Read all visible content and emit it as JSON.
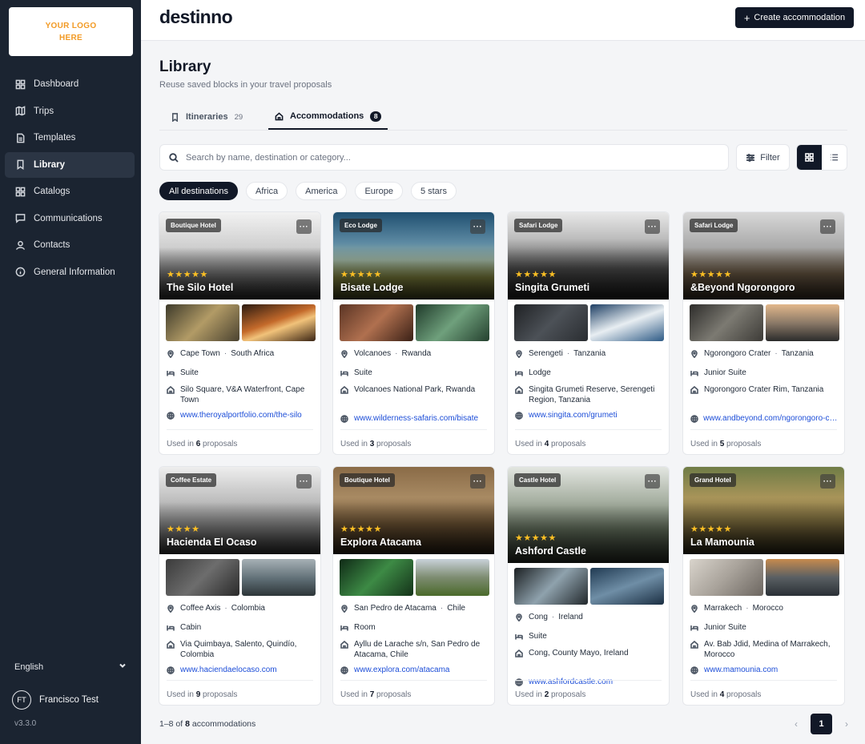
{
  "sidebar": {
    "logo_line1": "YOUR LOGO",
    "logo_line2": "HERE",
    "items": [
      {
        "label": "Dashboard",
        "icon": "grid-icon"
      },
      {
        "label": "Trips",
        "icon": "map-icon"
      },
      {
        "label": "Templates",
        "icon": "document-icon"
      },
      {
        "label": "Library",
        "icon": "bookmark-icon",
        "active": true
      },
      {
        "label": "Catalogs",
        "icon": "grid-icon"
      },
      {
        "label": "Communications",
        "icon": "chat-icon"
      },
      {
        "label": "Contacts",
        "icon": "user-icon"
      },
      {
        "label": "General Information",
        "icon": "info-icon"
      }
    ],
    "language": "English",
    "user_initials": "FT",
    "user_name": "Francisco Test",
    "version": "v3.3.0"
  },
  "header": {
    "brand": "destinno",
    "create_button": "Create accommodation"
  },
  "page": {
    "title": "Library",
    "subtitle": "Reuse saved blocks in your travel proposals"
  },
  "tabs": [
    {
      "label": "Itineraries",
      "count": "29"
    },
    {
      "label": "Accommodations",
      "count": "8",
      "active": true
    }
  ],
  "search": {
    "placeholder": "Search by name, destination or category..."
  },
  "filter_label": "Filter",
  "chips": [
    "All destinations",
    "Africa",
    "America",
    "Europe",
    "5 stars"
  ],
  "colors": {
    "sidebar_bg": "#1b2431",
    "accent": "#111827",
    "star": "#fbbf24",
    "link": "#1d4ed8",
    "logo_text": "#f29a24"
  },
  "cards": [
    {
      "badge": "Boutique Hotel",
      "stars": 5,
      "name": "The Silo Hotel",
      "city": "Cape Town",
      "country": "South Africa",
      "room": "Suite",
      "address": "Silo Square, V&A Waterfront, Cape Town",
      "url": "www.theroyalportfolio.com/the-silo",
      "used_prefix": "Used in",
      "used_count": "6",
      "used_suffix": "proposals"
    },
    {
      "badge": "Eco Lodge",
      "stars": 5,
      "name": "Bisate Lodge",
      "city": "Volcanoes",
      "country": "Rwanda",
      "room": "Suite",
      "address": "Volcanoes National Park, Rwanda",
      "url": "www.wilderness-safaris.com/bisate",
      "used_prefix": "Used in",
      "used_count": "3",
      "used_suffix": "proposals"
    },
    {
      "badge": "Safari Lodge",
      "stars": 5,
      "name": "Singita Grumeti",
      "city": "Serengeti",
      "country": "Tanzania",
      "room": "Lodge",
      "address": "Singita Grumeti Reserve, Serengeti Region, Tanzania",
      "url": "www.singita.com/grumeti",
      "used_prefix": "Used in",
      "used_count": "4",
      "used_suffix": "proposals"
    },
    {
      "badge": "Safari Lodge",
      "stars": 5,
      "name": "&Beyond Ngorongoro",
      "city": "Ngorongoro Crater",
      "country": "Tanzania",
      "room": "Junior Suite",
      "address": "Ngorongoro Crater Rim, Tanzania",
      "url": "www.andbeyond.com/ngorongoro-crater",
      "used_prefix": "Used in",
      "used_count": "5",
      "used_suffix": "proposals"
    },
    {
      "badge": "Coffee Estate",
      "stars": 4,
      "name": "Hacienda El Ocaso",
      "city": "Coffee Axis",
      "country": "Colombia",
      "room": "Cabin",
      "address": "Via Quimbaya, Salento, Quindío, Colombia",
      "url": "www.haciendaelocaso.com",
      "used_prefix": "Used in",
      "used_count": "9",
      "used_suffix": "proposals"
    },
    {
      "badge": "Boutique Hotel",
      "stars": 5,
      "name": "Explora Atacama",
      "city": "San Pedro de Atacama",
      "country": "Chile",
      "room": "Room",
      "address": "Ayllu de Larache s/n, San Pedro de Atacama, Chile",
      "url": "www.explora.com/atacama",
      "used_prefix": "Used in",
      "used_count": "7",
      "used_suffix": "proposals"
    },
    {
      "badge": "Castle Hotel",
      "stars": 5,
      "name": "Ashford Castle",
      "city": "Cong",
      "country": "Ireland",
      "room": "Suite",
      "address": "Cong, County Mayo, Ireland",
      "url": "www.ashfordcastle.com",
      "used_prefix": "Used in",
      "used_count": "2",
      "used_suffix": "proposals"
    },
    {
      "badge": "Grand Hotel",
      "stars": 5,
      "name": "La Mamounia",
      "city": "Marrakech",
      "country": "Morocco",
      "room": "Junior Suite",
      "address": "Av. Bab Jdid, Medina of Marrakech, Morocco",
      "url": "www.mamounia.com",
      "used_prefix": "Used in",
      "used_count": "4",
      "used_suffix": "proposals"
    }
  ],
  "footer": {
    "range": "1–8 of",
    "total": "8",
    "unit": "accommodations"
  },
  "pagination": {
    "current": "1",
    "prev": "‹",
    "next": "›"
  }
}
